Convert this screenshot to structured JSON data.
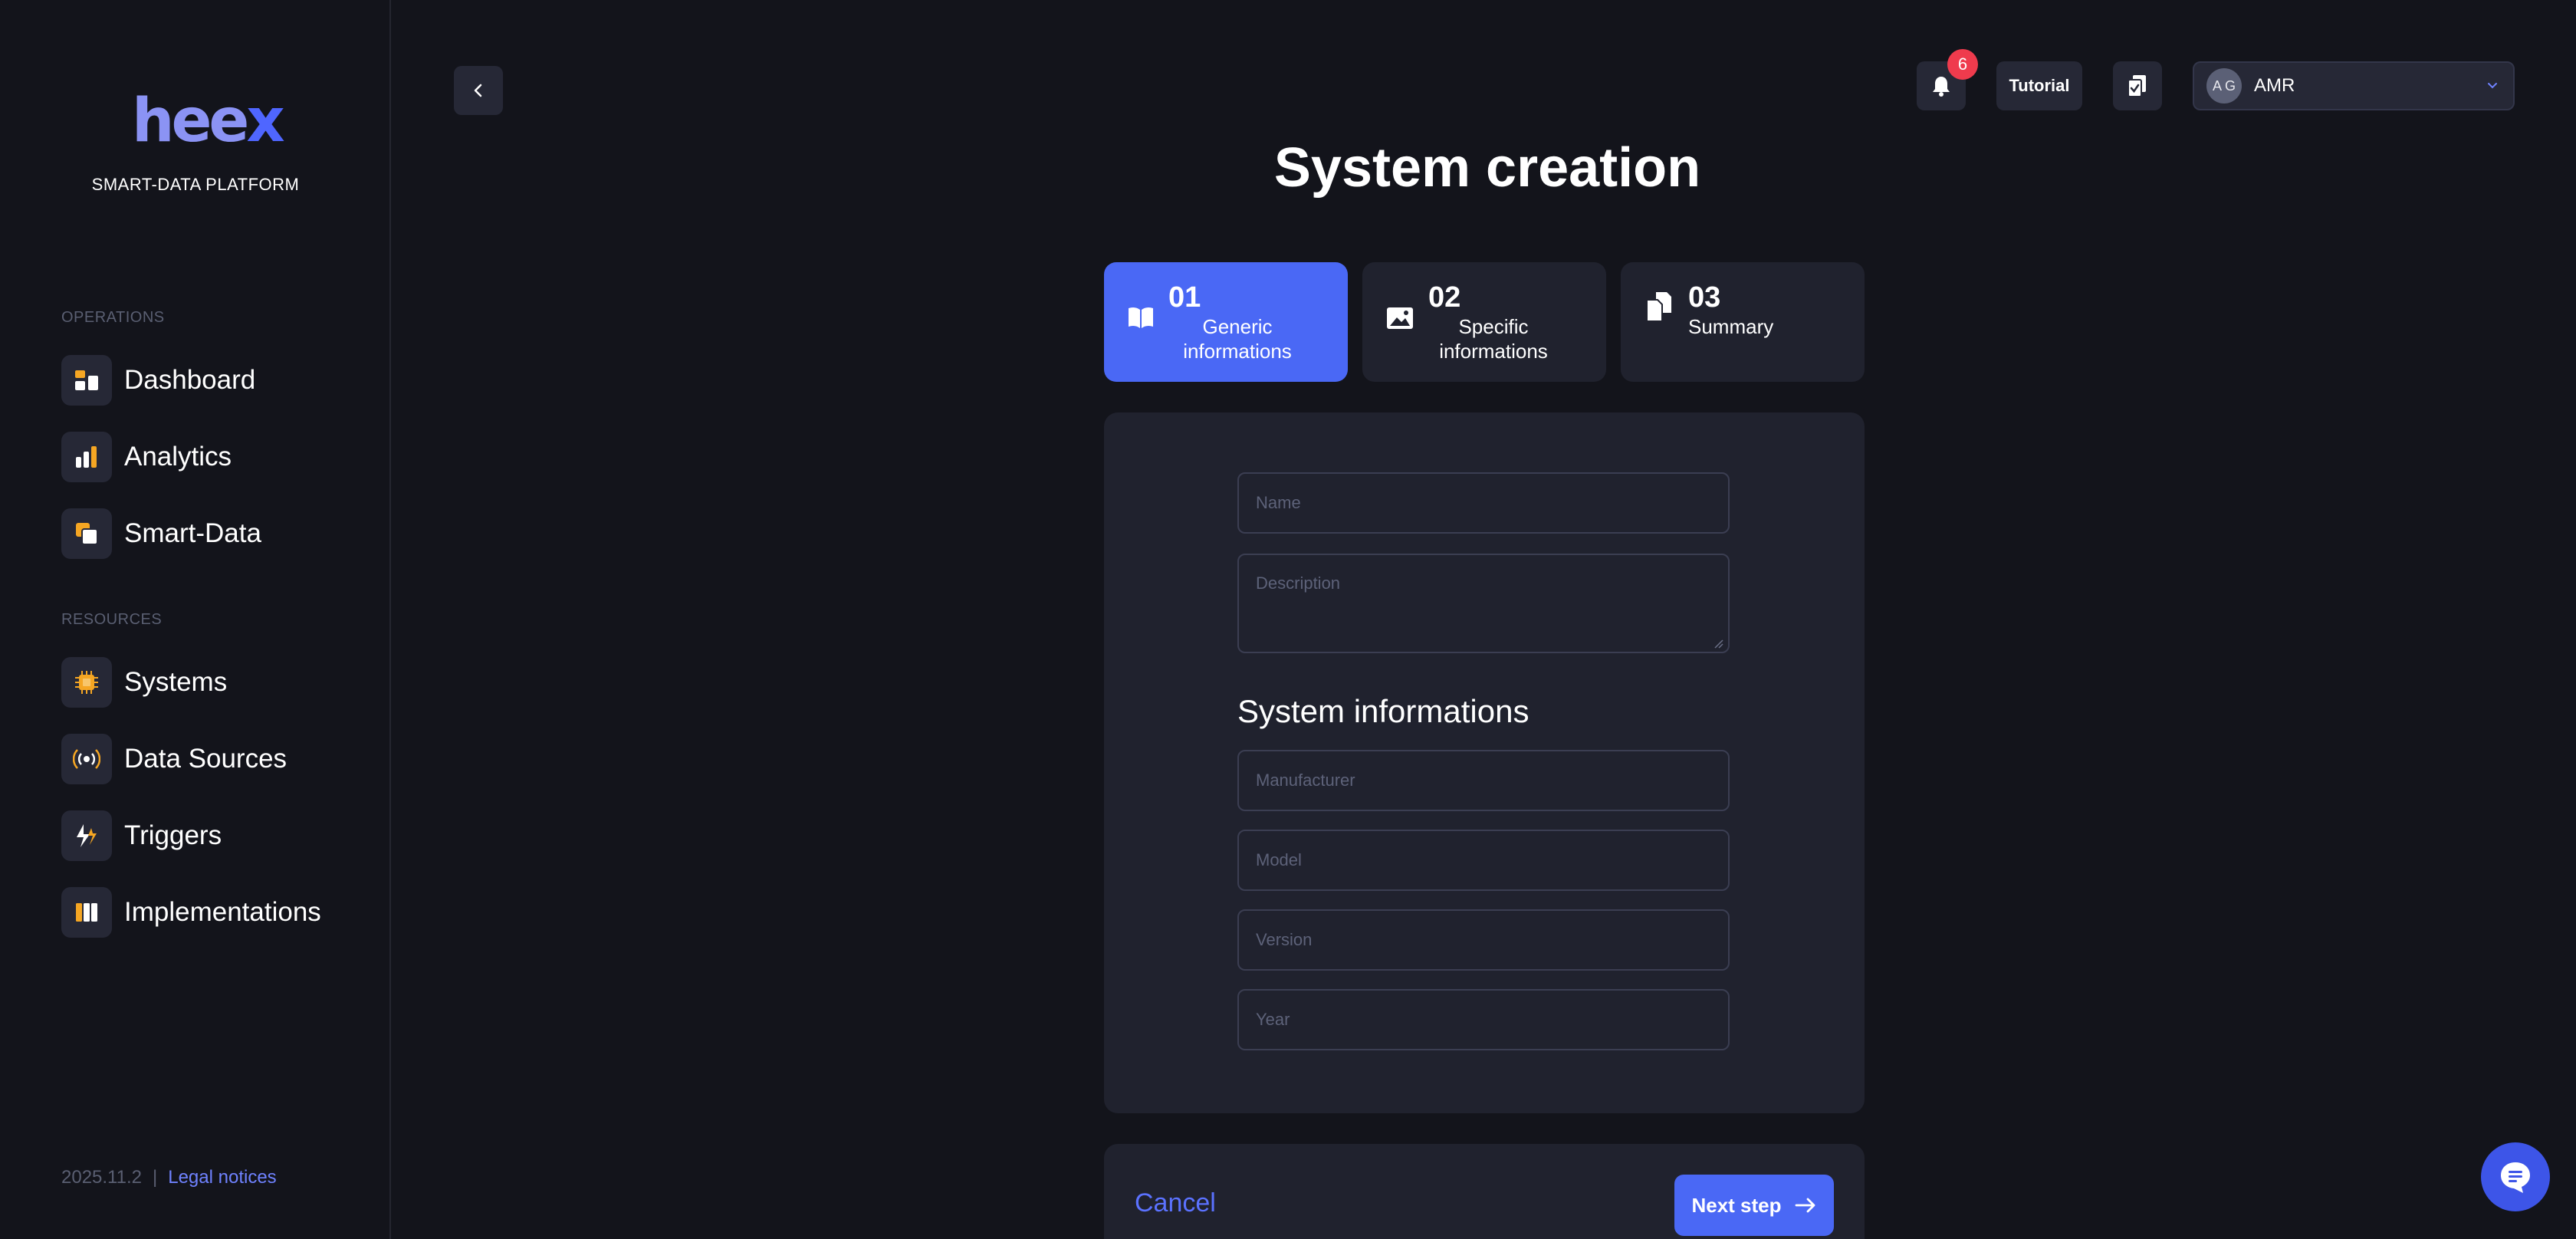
{
  "brand": {
    "logo_main": "hee",
    "logo_x": "x",
    "tagline": "SMART-DATA PLATFORM"
  },
  "sidebar": {
    "sections": [
      {
        "label": "OPERATIONS",
        "items": [
          {
            "label": "Dashboard",
            "icon": "dashboard-icon"
          },
          {
            "label": "Analytics",
            "icon": "bar-chart-icon"
          },
          {
            "label": "Smart-Data",
            "icon": "smart-data-icon"
          }
        ]
      },
      {
        "label": "RESOURCES",
        "items": [
          {
            "label": "Systems",
            "icon": "chip-icon"
          },
          {
            "label": "Data Sources",
            "icon": "broadcast-icon"
          },
          {
            "label": "Triggers",
            "icon": "lightning-icon"
          },
          {
            "label": "Implementations",
            "icon": "columns-icon"
          }
        ]
      }
    ],
    "footer": {
      "version": "2025.11.2",
      "separator": "|",
      "legal": "Legal notices"
    }
  },
  "header": {
    "notifications_count": "6",
    "tutorial_label": "Tutorial",
    "user": {
      "initials": "A G",
      "name": "AMR"
    }
  },
  "page": {
    "title": "System creation"
  },
  "steps": [
    {
      "number": "01",
      "label": "Generic informations",
      "active": true,
      "icon": "book-icon"
    },
    {
      "number": "02",
      "label": "Specific informations",
      "active": false,
      "icon": "image-icon"
    },
    {
      "number": "03",
      "label": "Summary",
      "active": false,
      "icon": "copy-icon"
    }
  ],
  "form": {
    "name_placeholder": "Name",
    "description_placeholder": "Description",
    "section_title": "System informations",
    "manufacturer_placeholder": "Manufacturer",
    "model_placeholder": "Model",
    "version_placeholder": "Version",
    "year_placeholder": "Year"
  },
  "actions": {
    "cancel_label": "Cancel",
    "next_label": "Next step"
  },
  "colors": {
    "background": "#13141b",
    "panel": "#20222e",
    "accent": "#4a68f5",
    "icon_orange": "#f5a623",
    "badge_red": "#ef3b4d"
  }
}
